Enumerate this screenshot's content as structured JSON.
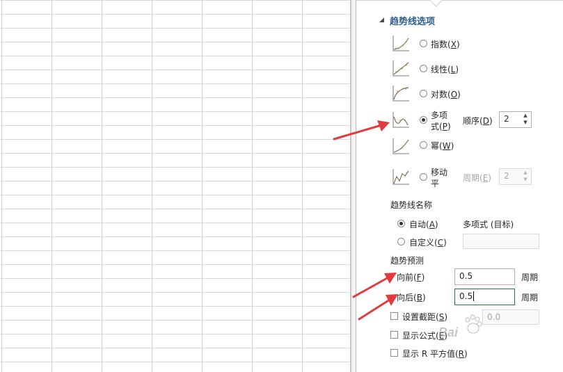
{
  "section": {
    "title": "趋势线选项"
  },
  "trend_types": [
    {
      "label": "指数",
      "key": "X",
      "selected": false
    },
    {
      "label": "线性",
      "key": "L",
      "selected": false
    },
    {
      "label": "对数",
      "key": "O",
      "selected": false
    },
    {
      "label_line1": "多项",
      "label_line2": "式",
      "key": "P",
      "selected": true
    },
    {
      "label": "幂",
      "key": "W",
      "selected": false
    },
    {
      "label_line1": "移动",
      "label_line2": "平",
      "selected": false
    }
  ],
  "order": {
    "label": "顺序",
    "key": "D",
    "value": "2"
  },
  "period": {
    "label": "周期",
    "key": "E",
    "value": "2"
  },
  "trend_name": {
    "title": "趋势线名称",
    "auto_label": "自动",
    "auto_key": "A",
    "auto_value": "多项式 (目标)",
    "custom_label": "自定义",
    "custom_key": "C"
  },
  "forecast": {
    "title": "趋势预测",
    "forward_label": "向前",
    "forward_key": "F",
    "forward_value": "0.5",
    "forward_unit": "周期",
    "backward_label": "向后",
    "backward_key": "B",
    "backward_value": "0.5",
    "backward_unit": "周期"
  },
  "options": {
    "intercept_label": "设置截距",
    "intercept_key": "S",
    "intercept_value": "0.0",
    "show_formula_label": "显示公式",
    "show_formula_key": "E",
    "show_r2_label": "显示 R 平方值",
    "show_r2_key": "R"
  },
  "watermark": {
    "text": "Bai"
  },
  "colors": {
    "arrow": "#e03c3c",
    "title": "#2f5e8c",
    "focus_border": "#217346"
  }
}
